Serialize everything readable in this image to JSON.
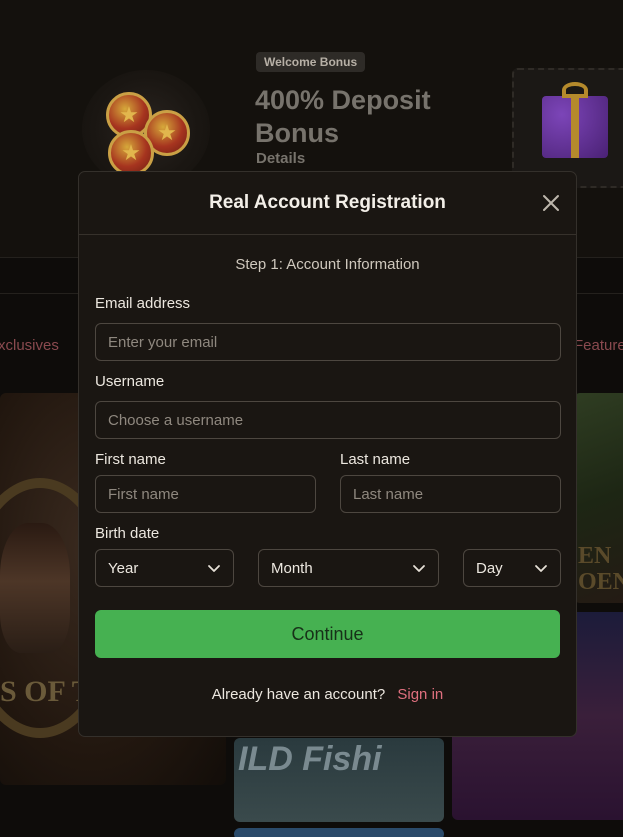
{
  "background": {
    "promo": {
      "badge": "Welcome Bonus",
      "title": "400% Deposit Bonus",
      "details_link": "Details"
    },
    "tabs": {
      "left_partial": "xclusives",
      "right_partial": "Feature"
    },
    "tiles": {
      "cleo_caption": "S OF TH",
      "right_top_text": "EN\nOEN",
      "fishing_text": "ILD Fishi"
    }
  },
  "modal": {
    "title": "Real Account Registration",
    "step": "Step 1: Account Information",
    "email": {
      "label": "Email address",
      "placeholder": "Enter your email",
      "value": ""
    },
    "username": {
      "label": "Username",
      "placeholder": "Choose a username",
      "value": ""
    },
    "first_name": {
      "label": "First name",
      "placeholder": "First name",
      "value": ""
    },
    "last_name": {
      "label": "Last name",
      "placeholder": "Last name",
      "value": ""
    },
    "birth_date": {
      "label": "Birth date",
      "year": "Year",
      "month": "Month",
      "day": "Day"
    },
    "continue_label": "Continue",
    "signin_prompt": "Already have an account?",
    "signin_link": "Sign in"
  },
  "colors": {
    "accent_green": "#46b151",
    "link_pink": "#e0707f",
    "modal_bg": "#1a1612"
  },
  "icons": {
    "close": "close-icon",
    "dropdown": "chevron-down-icon"
  }
}
